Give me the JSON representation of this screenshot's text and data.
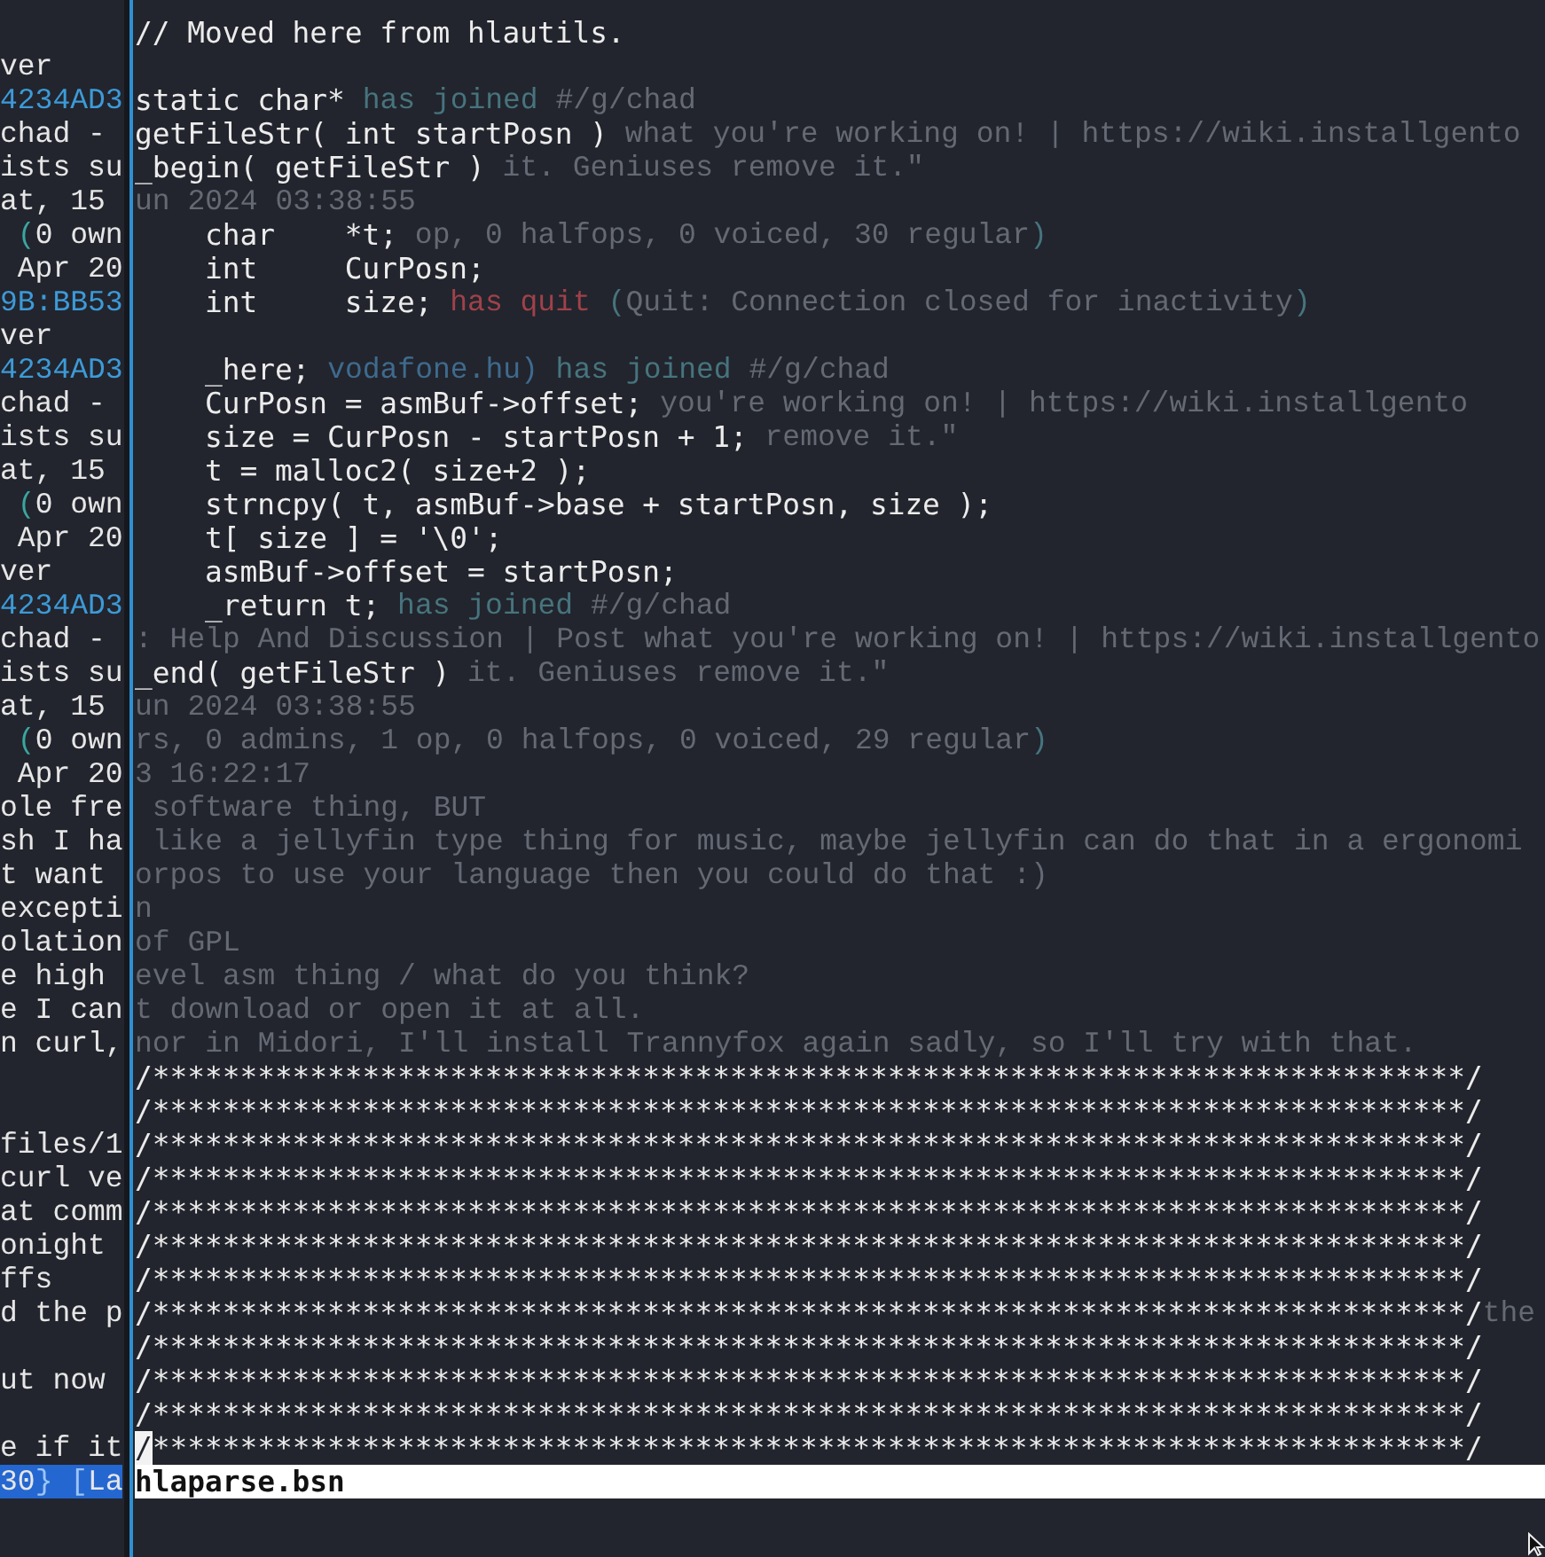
{
  "terminal": {
    "rows": [
      {
        "code": "// Moved here from hlautils.",
        "cursor": false
      },
      {
        "left": [
          {
            "text": "ver",
            "kind": "plain"
          }
        ]
      },
      {
        "left": [
          {
            "text": "4234AD3",
            "kind": "nick"
          }
        ],
        "code": "static char*",
        "cursor": false,
        "behind": [
          {
            "text": "has joined ",
            "kind": "join"
          },
          {
            "text": "#/g/chad",
            "kind": "muted"
          }
        ]
      },
      {
        "left": [
          {
            "text": "chad -",
            "kind": "plain"
          }
        ],
        "code": "getFileStr( int startPosn )",
        "cursor": false,
        "behind": [
          {
            "text": "what you're working on! | https://wiki.installgento",
            "kind": "muted"
          }
        ]
      },
      {
        "left": [
          {
            "text": "ists su",
            "kind": "plain"
          }
        ],
        "code": "_begin( getFileStr )",
        "cursor": false,
        "behind": [
          {
            "text": "it. Geniuses remove it.\"",
            "kind": "muted"
          }
        ]
      },
      {
        "left": [
          {
            "text": "at, 15",
            "kind": "plain"
          }
        ],
        "behind": [
          {
            "text": "un 2024 03:38:55",
            "kind": "muted"
          }
        ]
      },
      {
        "left": [
          {
            "text": " (",
            "kind": "teal"
          },
          {
            "text": "0 own",
            "kind": "plain"
          }
        ],
        "code": "    char    *t;",
        "cursor": false,
        "behind": [
          {
            "text": "op, 0 halfops, 0 voiced, 30 regular",
            "kind": "muted"
          },
          {
            "text": ")",
            "kind": "join"
          }
        ]
      },
      {
        "left": [
          {
            "text": " Apr 20",
            "kind": "plain"
          }
        ],
        "code": "    int     CurPosn;",
        "cursor": false
      },
      {
        "left": [
          {
            "text": "9B:BB53",
            "kind": "nick"
          }
        ],
        "code": "    int     size;",
        "cursor": false,
        "behind": [
          {
            "text": "has quit ",
            "kind": "quit"
          },
          {
            "text": "(",
            "kind": "join"
          },
          {
            "text": "Quit: Connection closed for inactivity",
            "kind": "muted"
          },
          {
            "text": ")",
            "kind": "join"
          }
        ]
      },
      {
        "left": [
          {
            "text": "ver",
            "kind": "plain"
          }
        ]
      },
      {
        "left": [
          {
            "text": "4234AD3",
            "kind": "nick"
          }
        ],
        "code": "    _here;",
        "cursor": false,
        "behind": [
          {
            "text": "vodafone.hu)",
            "kind": "host"
          },
          {
            "text": " has joined ",
            "kind": "join"
          },
          {
            "text": "#/g/chad",
            "kind": "muted"
          }
        ]
      },
      {
        "left": [
          {
            "text": "chad -",
            "kind": "plain"
          }
        ],
        "code": "    CurPosn = asmBuf->offset;",
        "cursor": false,
        "behind": [
          {
            "text": "you're working on! | https://wiki.installgento",
            "kind": "muted"
          }
        ]
      },
      {
        "left": [
          {
            "text": "ists su",
            "kind": "plain"
          }
        ],
        "code": "    size = CurPosn - startPosn + 1;",
        "cursor": false,
        "behind": [
          {
            "text": "remove it.\"",
            "kind": "muted"
          }
        ]
      },
      {
        "left": [
          {
            "text": "at, 15",
            "kind": "plain"
          }
        ],
        "code": "    t = malloc2( size+2 );",
        "cursor": false
      },
      {
        "left": [
          {
            "text": " (",
            "kind": "teal"
          },
          {
            "text": "0 own",
            "kind": "plain"
          }
        ],
        "code": "    strncpy( t, asmBuf->base + startPosn, size );",
        "cursor": false
      },
      {
        "left": [
          {
            "text": " Apr 20",
            "kind": "plain"
          }
        ],
        "code": "    t[ size ] = '\\0';",
        "cursor": false
      },
      {
        "left": [
          {
            "text": "ver",
            "kind": "plain"
          }
        ],
        "code": "    asmBuf->offset = startPosn;",
        "cursor": false
      },
      {
        "left": [
          {
            "text": "4234AD3",
            "kind": "nick"
          }
        ],
        "code": "    _return t;",
        "cursor": false,
        "behind": [
          {
            "text": "has joined ",
            "kind": "join"
          },
          {
            "text": "#/g/chad",
            "kind": "muted"
          }
        ]
      },
      {
        "left": [
          {
            "text": "chad -",
            "kind": "plain"
          }
        ],
        "behind": [
          {
            "text": ": Help And Discussion | Post what you're working on! | https://wiki.installgento",
            "kind": "muted"
          }
        ]
      },
      {
        "left": [
          {
            "text": "ists su",
            "kind": "plain"
          }
        ],
        "code": "_end( getFileStr )",
        "cursor": false,
        "behind": [
          {
            "text": "it. Geniuses remove it.\"",
            "kind": "muted"
          }
        ]
      },
      {
        "left": [
          {
            "text": "at, 15",
            "kind": "plain"
          }
        ],
        "behind": [
          {
            "text": "un 2024 03:38:55",
            "kind": "muted"
          }
        ]
      },
      {
        "left": [
          {
            "text": " (",
            "kind": "teal"
          },
          {
            "text": "0 own",
            "kind": "plain"
          }
        ],
        "behind": [
          {
            "text": "rs, 0 admins, 1 op, 0 halfops, 0 voiced, 29 regular",
            "kind": "muted"
          },
          {
            "text": ")",
            "kind": "join"
          }
        ]
      },
      {
        "left": [
          {
            "text": " Apr 20",
            "kind": "plain"
          }
        ],
        "behind": [
          {
            "text": "3 16:22:17",
            "kind": "muted"
          }
        ]
      },
      {
        "left": [
          {
            "text": "ole fre",
            "kind": "plain"
          }
        ],
        "behind": [
          {
            "text": " software thing, BUT",
            "kind": "muted"
          }
        ]
      },
      {
        "left": [
          {
            "text": "sh I ha",
            "kind": "plain"
          }
        ],
        "behind": [
          {
            "text": " like a jellyfin type thing for music, maybe jellyfin can do that in a ergonomi",
            "kind": "muted"
          }
        ]
      },
      {
        "left": [
          {
            "text": "t want",
            "kind": "plain"
          }
        ],
        "behind": [
          {
            "text": "orpos to use your language then you could do that :)",
            "kind": "muted"
          }
        ]
      },
      {
        "left": [
          {
            "text": "excepti",
            "kind": "plain"
          }
        ],
        "behind": [
          {
            "text": "n",
            "kind": "muted"
          }
        ]
      },
      {
        "left": [
          {
            "text": "olation",
            "kind": "plain"
          }
        ],
        "behind": [
          {
            "text": "of GPL",
            "kind": "muted"
          }
        ]
      },
      {
        "left": [
          {
            "text": "e high",
            "kind": "plain"
          }
        ],
        "behind": [
          {
            "text": "evel asm thing / what do you think?",
            "kind": "muted"
          }
        ]
      },
      {
        "left": [
          {
            "text": "e I can",
            "kind": "plain"
          }
        ],
        "behind": [
          {
            "text": "t download or open it at all.",
            "kind": "muted"
          }
        ]
      },
      {
        "left": [
          {
            "text": "n curl,",
            "kind": "plain"
          }
        ],
        "behind": [
          {
            "text": "nor in Midori, I'll install Trannyfox again sadly, so I'll try with that.",
            "kind": "muted"
          }
        ]
      },
      {
        "code": "/***************************************************************************/",
        "cursor": false
      },
      {
        "code": "/***************************************************************************/",
        "cursor": false
      },
      {
        "left": [
          {
            "text": "files/1",
            "kind": "plain"
          }
        ],
        "code": "/***************************************************************************/",
        "cursor": false
      },
      {
        "left": [
          {
            "text": "curl ve",
            "kind": "plain"
          }
        ],
        "code": "/***************************************************************************/",
        "cursor": false
      },
      {
        "left": [
          {
            "text": "at comm",
            "kind": "plain"
          }
        ],
        "code": "/***************************************************************************/",
        "cursor": false
      },
      {
        "left": [
          {
            "text": "onight",
            "kind": "plain"
          }
        ],
        "code": "/***************************************************************************/",
        "cursor": false
      },
      {
        "left": [
          {
            "text": "ffs",
            "kind": "plain"
          }
        ],
        "code": "/***************************************************************************/",
        "cursor": false
      },
      {
        "left": [
          {
            "text": "d the p",
            "kind": "plain"
          }
        ],
        "code": "/***************************************************************************/",
        "cursor": false,
        "behind": [
          {
            "text": "the",
            "kind": "muted"
          }
        ]
      },
      {
        "code": "/***************************************************************************/",
        "cursor": false
      },
      {
        "left": [
          {
            "text": "ut now",
            "kind": "plain"
          }
        ],
        "code": "/***************************************************************************/",
        "cursor": false
      },
      {
        "code": "/***************************************************************************/",
        "cursor": false
      },
      {
        "left": [
          {
            "text": "e if it",
            "kind": "plain"
          }
        ],
        "code": "/***************************************************************************/",
        "cursor": true
      }
    ],
    "status_row": {
      "left": [
        {
          "text": "30",
          "kind": "plain"
        },
        {
          "text": "} [",
          "kind": "dim"
        },
        {
          "text": "La",
          "kind": "plain"
        }
      ],
      "highlighted": true,
      "file_name": "hlaparse.bsn"
    }
  }
}
